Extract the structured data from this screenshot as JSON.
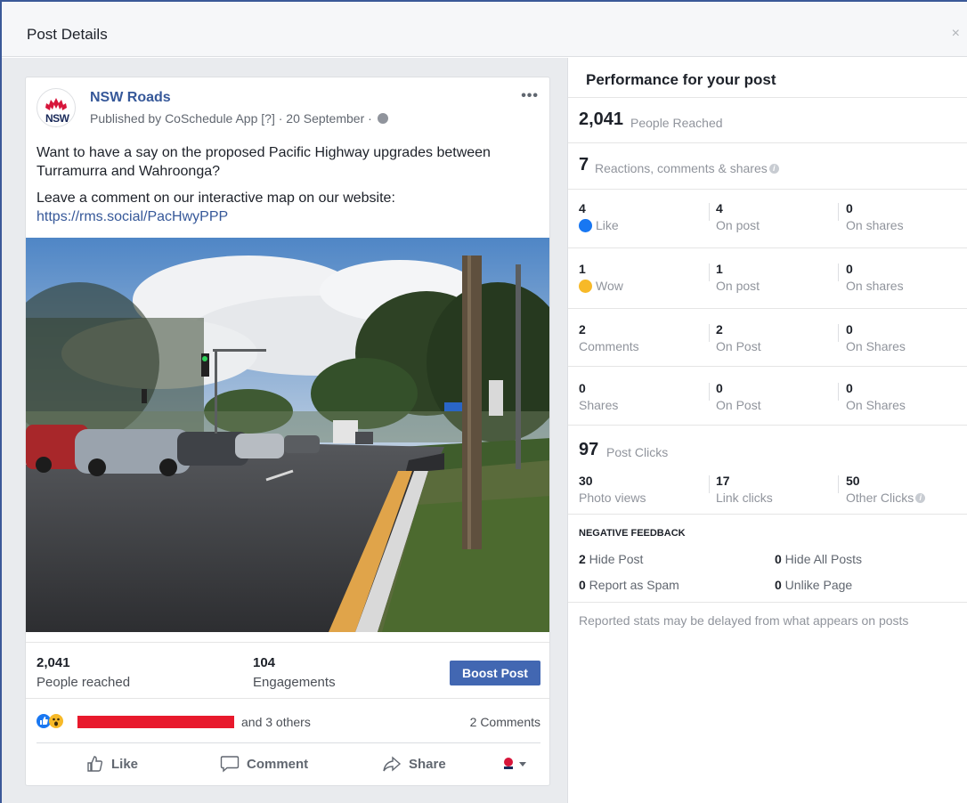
{
  "dialog": {
    "title": "Post Details",
    "close_glyph": "×"
  },
  "post": {
    "page_name": "NSW Roads",
    "avatar_text": "NSW",
    "published_prefix": "Published by ",
    "published_app": "CoSchedule App",
    "published_help": " [?] · ",
    "published_date": "20 September · ",
    "more_glyph": "•••",
    "text_line1": "Want to have a say on the proposed Pacific Highway upgrades between Turramurra and Wahroonga?",
    "text_line2_prefix": "Leave a comment on our interactive map on our website: ",
    "text_link": "https://rms.social/PacHwyPPP",
    "stats": {
      "reached_value": "2,041",
      "reached_label": "People reached",
      "engagements_value": "104",
      "engagements_label": "Engagements",
      "boost_label": "Boost Post"
    },
    "reactions_others": "and 3 others",
    "comments_count": "2 Comments",
    "actions": {
      "like": "Like",
      "comment": "Comment",
      "share": "Share"
    }
  },
  "performance": {
    "title": "Performance for your post",
    "reached_value": "2,041",
    "reached_label": "People Reached",
    "reactions_value": "7",
    "reactions_label": "Reactions, comments & shares",
    "rows": [
      {
        "name": "like",
        "a_value": "4",
        "a_label": "Like",
        "b_value": "4",
        "b_label": "On post",
        "c_value": "0",
        "c_label": "On shares"
      },
      {
        "name": "wow",
        "a_value": "1",
        "a_label": "Wow",
        "b_value": "1",
        "b_label": "On post",
        "c_value": "0",
        "c_label": "On shares"
      },
      {
        "name": "comments",
        "a_value": "2",
        "a_label": "Comments",
        "b_value": "2",
        "b_label": "On Post",
        "c_value": "0",
        "c_label": "On Shares"
      },
      {
        "name": "shares",
        "a_value": "0",
        "a_label": "Shares",
        "b_value": "0",
        "b_label": "On Post",
        "c_value": "0",
        "c_label": "On Shares"
      }
    ],
    "clicks_value": "97",
    "clicks_label": "Post Clicks",
    "clicks": [
      {
        "value": "30",
        "label": "Photo views"
      },
      {
        "value": "17",
        "label": "Link clicks"
      },
      {
        "value": "50",
        "label": "Other Clicks"
      }
    ],
    "negative_title": "NEGATIVE FEEDBACK",
    "negative": [
      {
        "value": "2",
        "label": " Hide Post"
      },
      {
        "value": "0",
        "label": " Hide All Posts"
      },
      {
        "value": "0",
        "label": " Report as Spam"
      },
      {
        "value": "0",
        "label": " Unlike Page"
      }
    ],
    "footnote": "Reported stats may be delayed from what appears on posts"
  },
  "colors": {
    "facebook_blue": "#4267b2",
    "link_blue": "#365899",
    "like_blue": "#1877f2",
    "wow_yellow": "#f7b928",
    "redaction_red": "#e8192c",
    "waratah_red": "#d7153a"
  },
  "icons": [
    "close-icon",
    "waratah-logo-icon",
    "globe-icon",
    "more-options-icon",
    "like-reaction-icon",
    "wow-reaction-icon",
    "thumbs-up-icon",
    "comment-bubble-icon",
    "share-arrow-icon",
    "info-icon",
    "chevron-down-icon"
  ]
}
